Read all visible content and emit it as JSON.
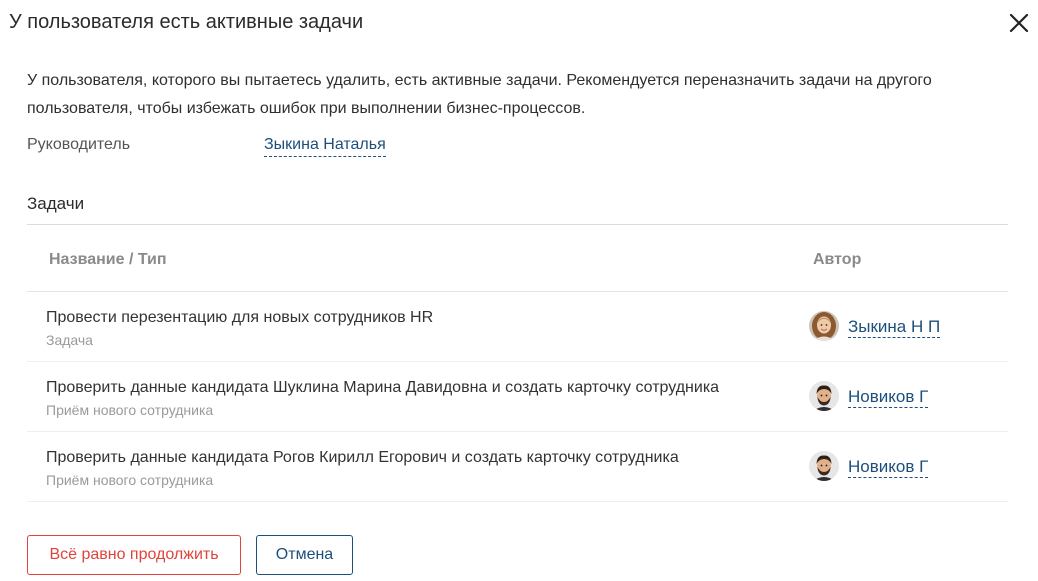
{
  "dialog": {
    "title": "У пользователя есть активные задачи",
    "close_icon": "close-icon"
  },
  "intro": {
    "text": "У пользователя, которого вы пытаетесь удалить, есть активные задачи. Рекомендуется переназначить задачи на другого пользователя, чтобы избежать ошибок при выполнении бизнес-процессов."
  },
  "manager": {
    "label": "Руководитель",
    "name": "Зыкина Наталья"
  },
  "tasks_section": {
    "title": "Задачи",
    "columns": {
      "name": "Название / Тип",
      "author": "Автор"
    },
    "rows": [
      {
        "title": "Провести перезентацию для новых сотрудников HR",
        "type": "Задача",
        "author": "Зыкина Н П",
        "avatar": "female-avatar"
      },
      {
        "title": "Проверить данные кандидата Шуклина Марина Давидовна и создать карточку сотрудника",
        "type": "Приём нового сотрудника",
        "author": "Новиков Г",
        "avatar": "male-avatar"
      },
      {
        "title": "Проверить данные кандидата Рогов Кирилл Егорович и создать карточку сотрудника",
        "type": "Приём нового сотрудника",
        "author": "Новиков Г",
        "avatar": "male-avatar"
      }
    ]
  },
  "buttons": {
    "continue_label": "Всё равно продолжить",
    "cancel_label": "Отмена"
  },
  "colors": {
    "link": "#1d4f7c",
    "danger": "#e0433a",
    "text": "#333333",
    "muted": "#9a9a9a"
  }
}
